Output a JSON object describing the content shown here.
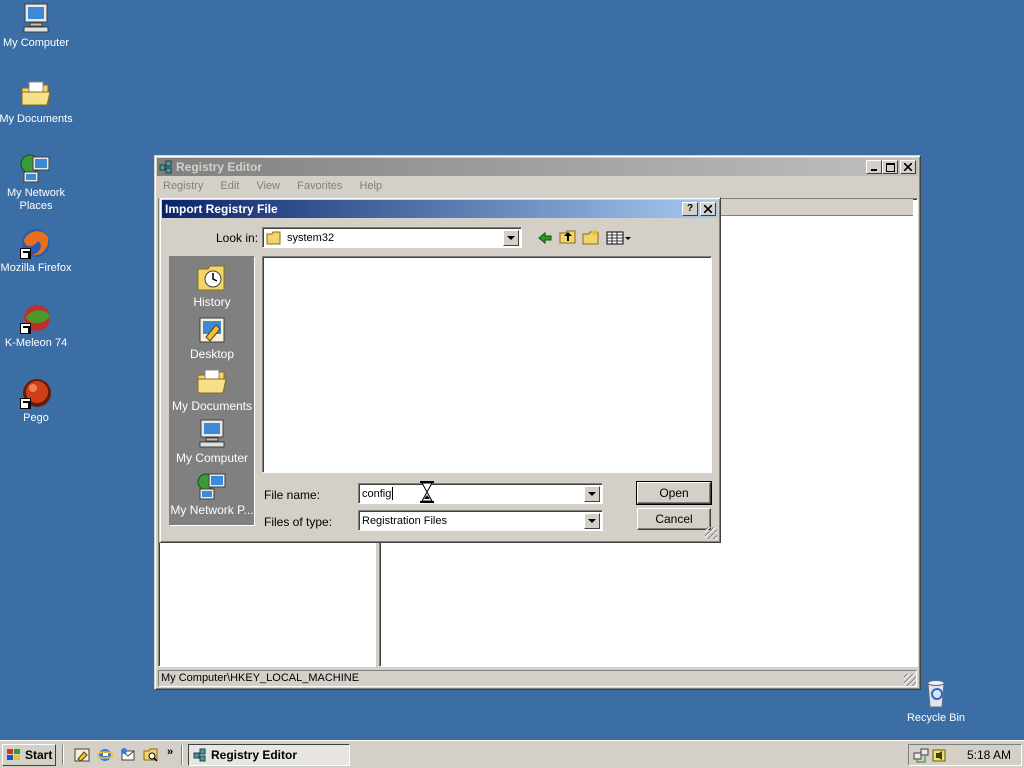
{
  "desktop": {
    "icons": [
      {
        "label": "My Computer"
      },
      {
        "label": "My Documents"
      },
      {
        "label": "My Network Places"
      },
      {
        "label": "Mozilla Firefox"
      },
      {
        "label": "K-Meleon 74"
      },
      {
        "label": "Pego"
      },
      {
        "label": "Recycle Bin"
      }
    ]
  },
  "regedit": {
    "title": "Registry Editor",
    "menu": [
      "Registry",
      "Edit",
      "View",
      "Favorites",
      "Help"
    ],
    "status": "My Computer\\HKEY_LOCAL_MACHINE"
  },
  "dialog": {
    "title": "Import Registry File",
    "look_in_label": "Look in:",
    "look_in_value": "system32",
    "places": [
      "History",
      "Desktop",
      "My Documents",
      "My Computer",
      "My Network P..."
    ],
    "file_name_label": "File name:",
    "file_name_value": "config",
    "files_of_type_label": "Files of type:",
    "files_of_type_value": "Registration Files",
    "open_label": "Open",
    "cancel_label": "Cancel",
    "help_btn": "?",
    "close_btn": "✕"
  },
  "taskbar": {
    "start_label": "Start",
    "task_label": "Registry Editor",
    "clock": "5:18 AM"
  },
  "colors": {
    "desktop": "#3a6ea5",
    "title_active": "#0a246a",
    "title_inactive": "#808080",
    "face": "#d4d0c8"
  }
}
